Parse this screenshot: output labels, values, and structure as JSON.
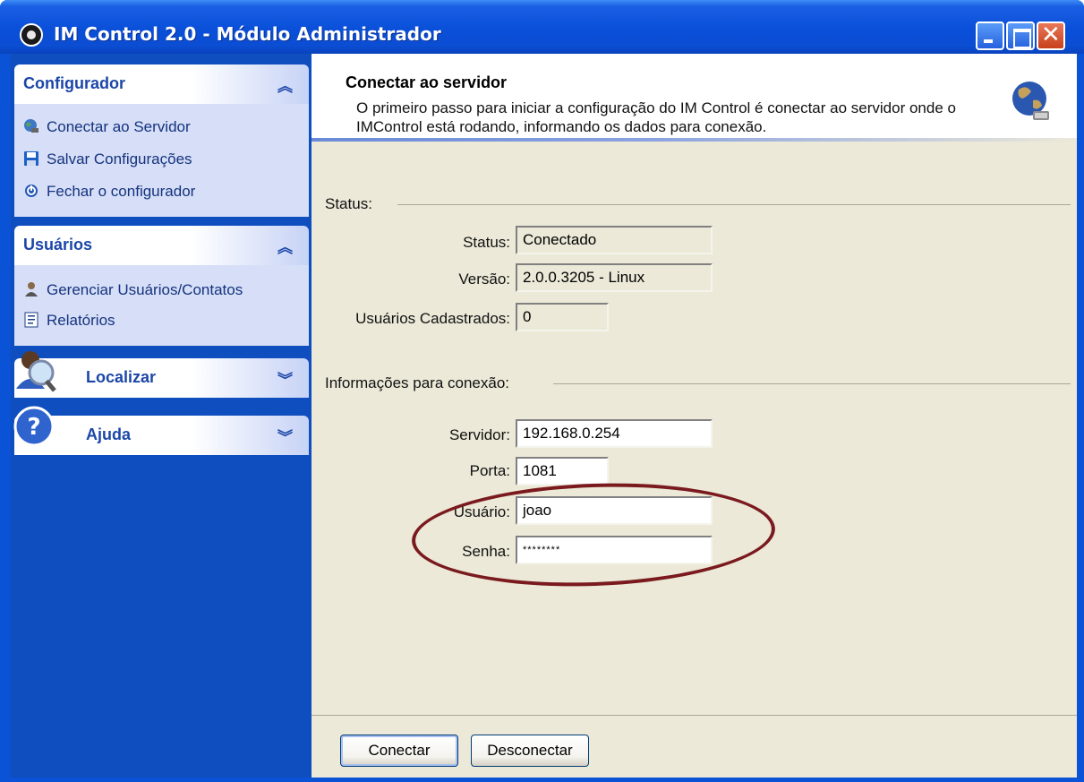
{
  "window": {
    "title": "IM Control 2.0 - Módulo Administrador",
    "controls": [
      "minimize",
      "maximize",
      "close"
    ]
  },
  "sidebar": {
    "groups": [
      {
        "title": "Configurador",
        "chevron": "⌃",
        "items": [
          {
            "label": "Conectar ao Servidor",
            "icon": "globe-connect-icon"
          },
          {
            "label": "Salvar Configurações",
            "icon": "floppy-disk-icon"
          },
          {
            "label": "Fechar o configurador",
            "icon": "power-icon"
          }
        ]
      },
      {
        "title": "Usuários",
        "chevron": "⌃",
        "items": [
          {
            "label": "Gerenciar Usuários/Contatos",
            "icon": "user-icon"
          },
          {
            "label": "Relatórios",
            "icon": "report-icon"
          }
        ]
      },
      {
        "title": "Localizar",
        "chevron": "⌄",
        "icon": "search-user-icon"
      },
      {
        "title": "Ajuda",
        "chevron": "⌄",
        "icon": "help-icon"
      }
    ]
  },
  "header": {
    "title": "Conectar ao servidor",
    "description": "O primeiro passo para iniciar a configuração do IM Control é conectar ao servidor onde o IMControl está rodando, informando os dados para conexão."
  },
  "status_section": {
    "label": "Status:",
    "fields": [
      {
        "label": "Status:",
        "value": "Conectado"
      },
      {
        "label": "Versão:",
        "value": "2.0.0.3205 - Linux"
      },
      {
        "label": "Usuários Cadastrados:",
        "value": "0"
      }
    ]
  },
  "connection_section": {
    "label": "Informações para conexão:",
    "fields": [
      {
        "label": "Servidor:",
        "value": "192.168.0.254"
      },
      {
        "label": "Porta:",
        "value": "1081"
      },
      {
        "label": "Usuário:",
        "value": "joao"
      },
      {
        "label": "Senha:",
        "value": "********"
      }
    ]
  },
  "buttons": {
    "connect": "Conectar",
    "disconnect": "Desconectar"
  },
  "colors": {
    "titlebar": "#0a4fd8",
    "sidebar": "#0e4ebe",
    "panel": "#ece9d8",
    "annotation": "#7a1a1e"
  }
}
